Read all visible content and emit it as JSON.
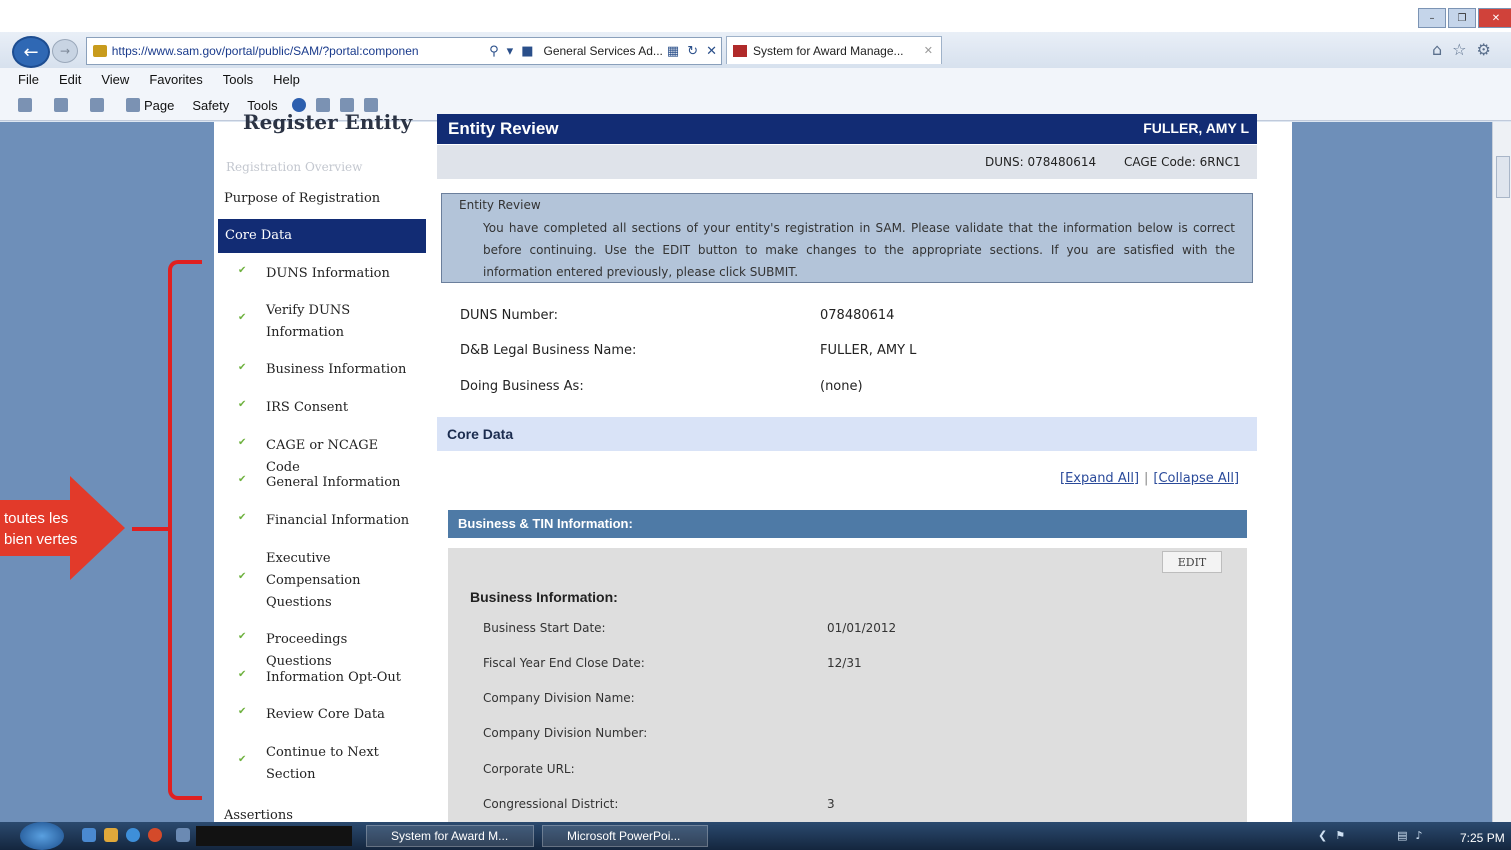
{
  "browser": {
    "url": "https://www.sam.gov/portal/public/SAM/?portal:componen",
    "site_tab_label": "General Services Ad...",
    "active_tab_label": "System for Award Manage...",
    "menu": [
      "File",
      "Edit",
      "View",
      "Favorites",
      "Tools",
      "Help"
    ],
    "command_bar": {
      "page": "Page",
      "safety": "Safety",
      "tools": "Tools"
    }
  },
  "sidebar": {
    "title": "Register Entity",
    "intro_item": "Registration Overview",
    "purpose": "Purpose of Registration",
    "core_data": "Core Data",
    "items": [
      {
        "label": "DUNS Information"
      },
      {
        "label": "Verify DUNS Information"
      },
      {
        "label": "Business Information"
      },
      {
        "label": "IRS Consent"
      },
      {
        "label": "CAGE or NCAGE Code"
      },
      {
        "label": "General Information"
      },
      {
        "label": "Financial Information"
      },
      {
        "label": "Executive Compensation Questions"
      },
      {
        "label": "Proceedings Questions"
      },
      {
        "label": "Information Opt-Out"
      },
      {
        "label": "Review Core Data"
      },
      {
        "label": "Continue to Next Section"
      }
    ],
    "assertions": "Assertions"
  },
  "annotation": {
    "line1": "toutes les",
    "line2": "bien vertes"
  },
  "header": {
    "title": "Entity Review",
    "entity_name": "FULLER, AMY L",
    "duns": "DUNS: 078480614",
    "cage": "CAGE Code: 6RNC1"
  },
  "review": {
    "title": "Entity Review",
    "body": "You have completed all sections of your entity's registration in SAM. Please validate that the information below is correct before continuing. Use the EDIT button to make changes to the appropriate sections. If you are satisfied with the information entered previously, please click SUBMIT."
  },
  "summary": [
    {
      "label": "DUNS Number:",
      "value": "078480614"
    },
    {
      "label": "D&B Legal Business Name:",
      "value": "FULLER, AMY L"
    },
    {
      "label": "Doing Business As:",
      "value": "(none)"
    }
  ],
  "core_section": {
    "title": "Core Data",
    "expand_all": "[Expand All]",
    "collapse_all": "[Collapse All]",
    "business_header": "Business & TIN Information:",
    "edit": "EDIT",
    "business_subtitle": "Business Information:",
    "fields": [
      {
        "label": "Business Start Date:",
        "value": "01/01/2012"
      },
      {
        "label": "Fiscal Year End Close Date:",
        "value": "12/31"
      },
      {
        "label": "Company Division Name:",
        "value": ""
      },
      {
        "label": "Company Division Number:",
        "value": ""
      },
      {
        "label": "Corporate URL:",
        "value": ""
      },
      {
        "label": "Congressional District:",
        "value": "3"
      }
    ]
  },
  "taskbar": {
    "task1": "System for Award M...",
    "task2": "Microsoft PowerPoi...",
    "clock": "7:25 PM"
  }
}
